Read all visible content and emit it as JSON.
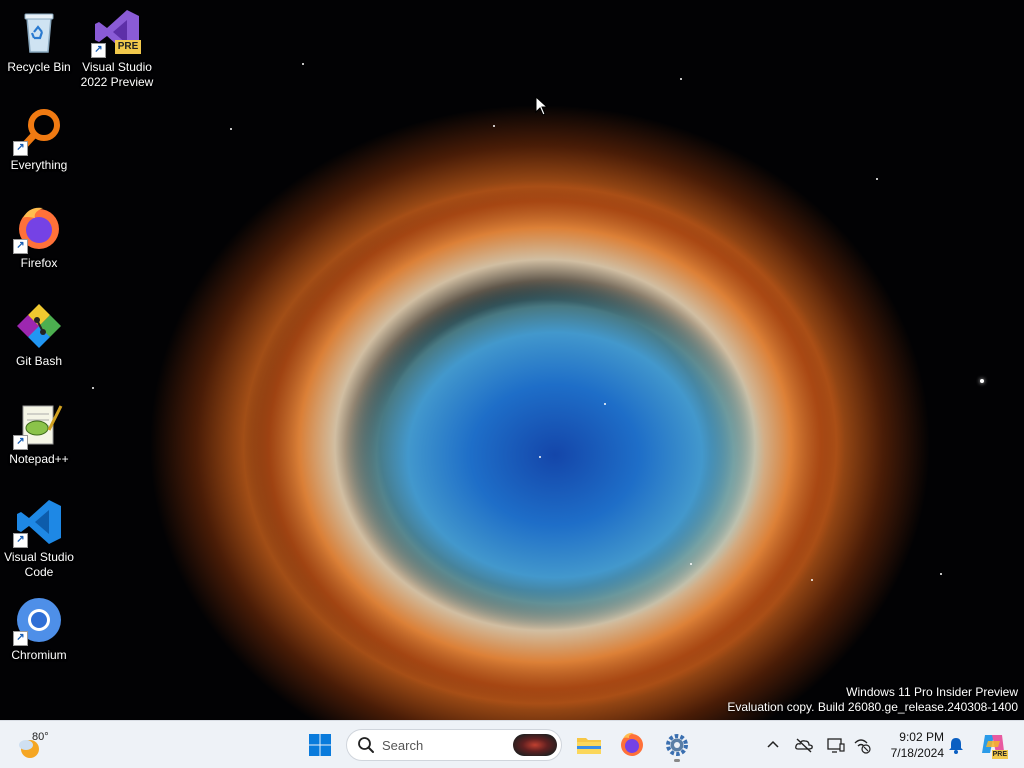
{
  "desktop": {
    "icons": [
      {
        "label": "Recycle Bin"
      },
      {
        "label": "Visual Studio 2022 Preview",
        "badge": "PRE"
      },
      {
        "label": "Everything"
      },
      {
        "label": "Firefox"
      },
      {
        "label": "Git Bash"
      },
      {
        "label": "Notepad++"
      },
      {
        "label": "Visual Studio Code"
      },
      {
        "label": "Chromium"
      }
    ]
  },
  "watermark": {
    "line1": "Windows 11 Pro Insider Preview",
    "line2": "Evaluation copy. Build 26080.ge_release.240308-1400"
  },
  "taskbar": {
    "weather": {
      "temp": "80°",
      "icon": "sun-cloud-icon"
    },
    "start": {
      "icon": "windows-start-icon"
    },
    "search": {
      "placeholder": "Search"
    },
    "pinned": [
      {
        "name": "File Explorer",
        "icon": "folder-icon"
      },
      {
        "name": "Firefox",
        "icon": "firefox-icon"
      },
      {
        "name": "Settings",
        "icon": "gear-icon",
        "active": true
      }
    ],
    "tray": {
      "icons": [
        "chevron-up-icon",
        "onedrive-offline-icon",
        "display-icon",
        "network-disconnected-icon"
      ],
      "time": "9:02 PM",
      "date": "7/18/2024",
      "notification_icon": "bell-icon",
      "copilot_badge": "PRE"
    }
  },
  "colors": {
    "taskbar_bg": "#eef2f7",
    "accent": "#0067c0"
  }
}
